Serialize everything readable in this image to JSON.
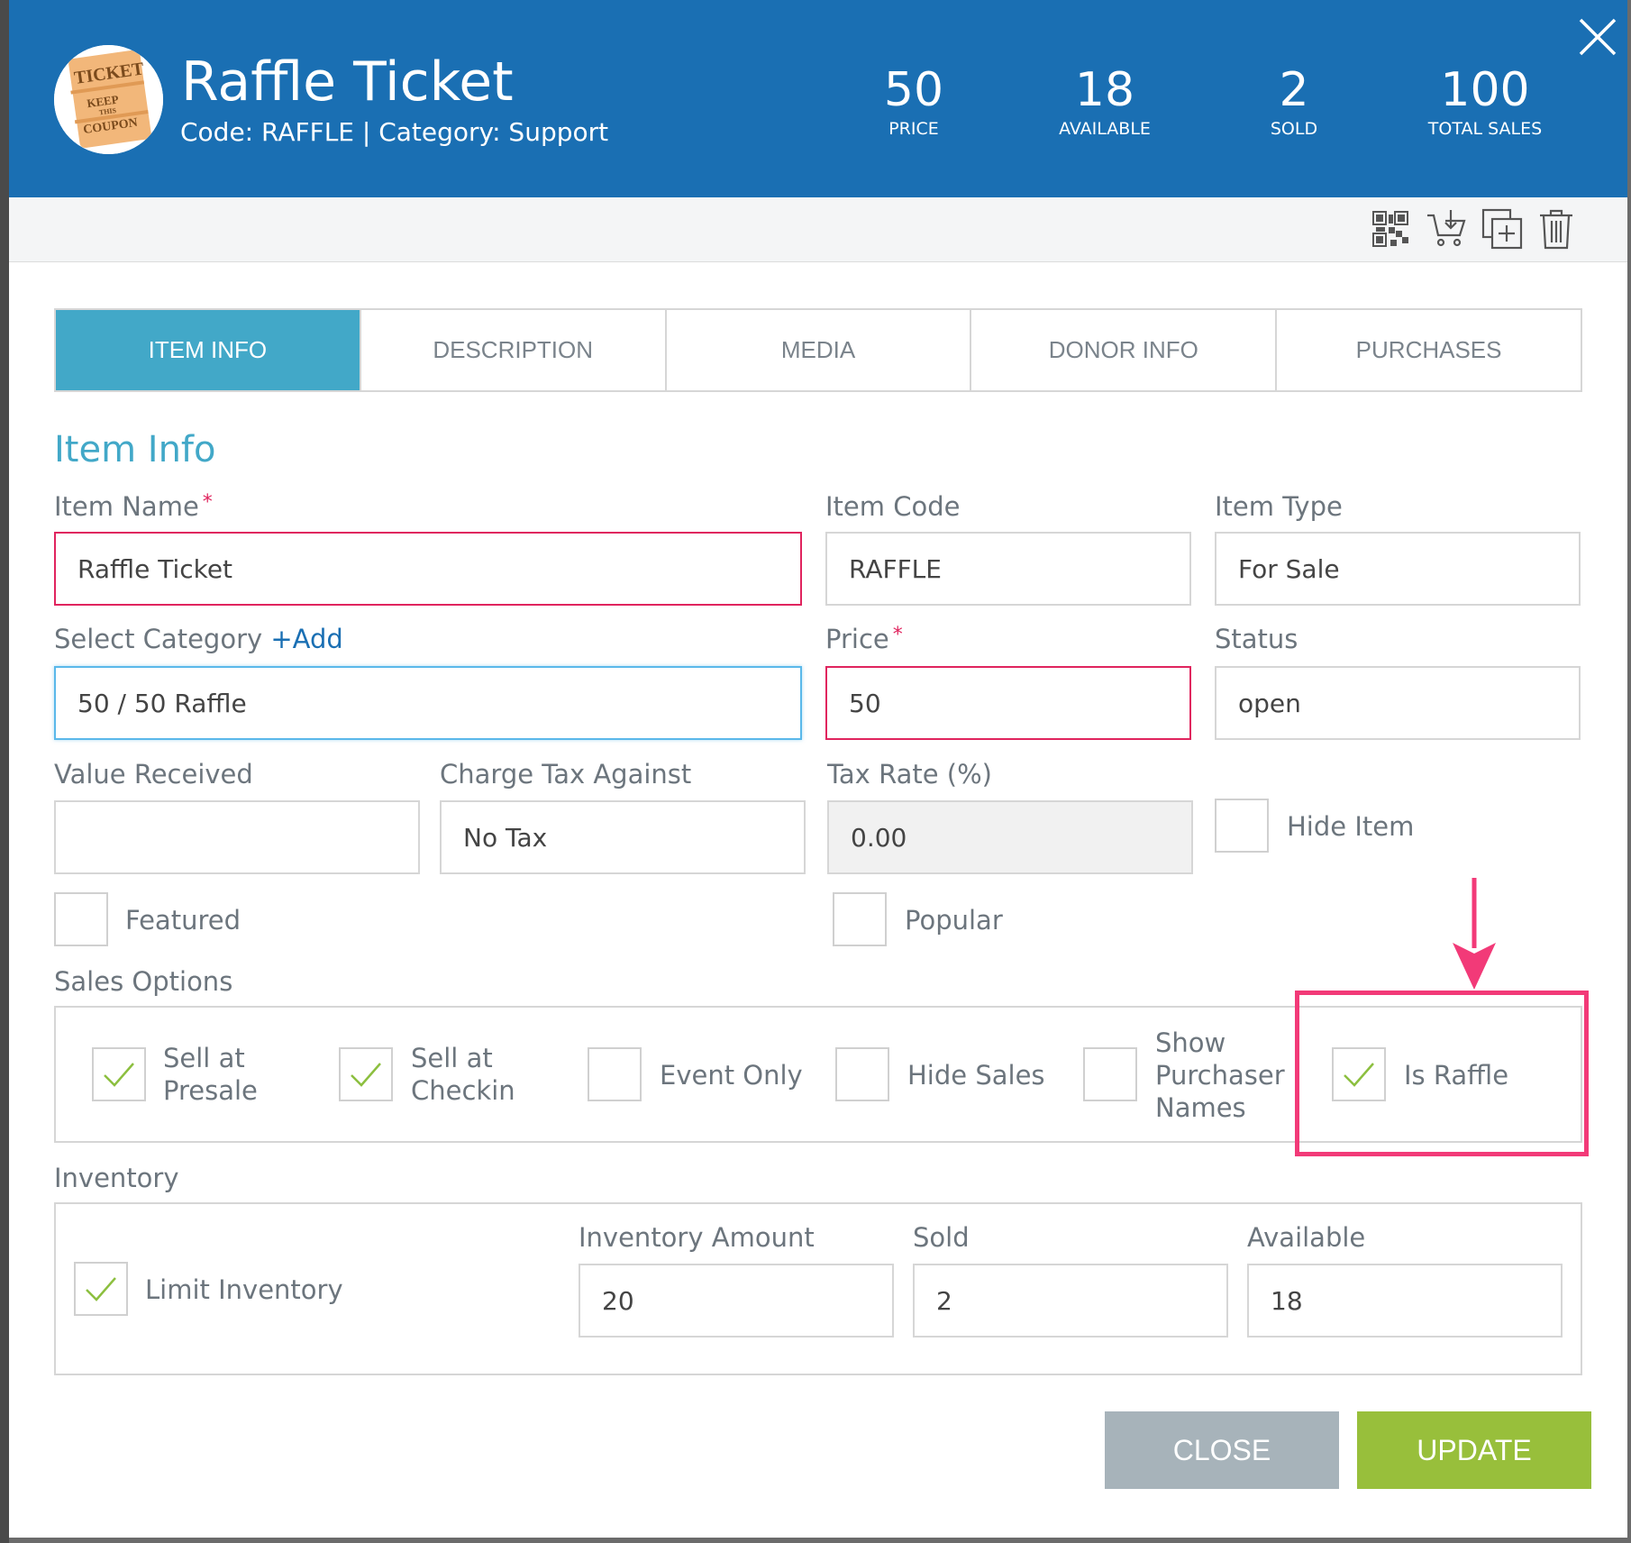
{
  "header": {
    "title": "Raffle Ticket",
    "subtitle": "Code: RAFFLE | Category: Support",
    "stats": [
      {
        "value": "50",
        "label": "PRICE"
      },
      {
        "value": "18",
        "label": "AVAILABLE"
      },
      {
        "value": "2",
        "label": "SOLD"
      },
      {
        "value": "100",
        "label": "TOTAL SALES"
      }
    ],
    "image_text": [
      "TICKET",
      "KEEP",
      "THIS",
      "COUPON"
    ]
  },
  "toolbar": {
    "icons": [
      "qr-code-icon",
      "cart-download-icon",
      "duplicate-icon",
      "trash-icon"
    ]
  },
  "tabs": [
    {
      "label": "ITEM INFO",
      "active": true
    },
    {
      "label": "DESCRIPTION",
      "active": false
    },
    {
      "label": "MEDIA",
      "active": false
    },
    {
      "label": "DONOR INFO",
      "active": false
    },
    {
      "label": "PURCHASES",
      "active": false
    }
  ],
  "form": {
    "section_title": "Item Info",
    "required_mark": "*",
    "item_name": {
      "label": "Item Name",
      "value": "Raffle Ticket"
    },
    "item_code": {
      "label": "Item Code",
      "value": "RAFFLE"
    },
    "item_type": {
      "label": "Item Type",
      "value": "For Sale"
    },
    "category": {
      "label": "Select Category",
      "add_label": "+Add",
      "value": "50 / 50 Raffle"
    },
    "price": {
      "label": "Price",
      "value": "50"
    },
    "status": {
      "label": "Status",
      "value": "open"
    },
    "value_received": {
      "label": "Value Received",
      "value": ""
    },
    "charge_tax": {
      "label": "Charge Tax Against",
      "value": "No Tax"
    },
    "tax_rate": {
      "label": "Tax Rate (%)",
      "value": "0.00"
    },
    "hide_item": {
      "label": "Hide Item",
      "checked": false
    },
    "featured": {
      "label": "Featured",
      "checked": false
    },
    "popular": {
      "label": "Popular",
      "checked": false
    }
  },
  "sales_options": {
    "title": "Sales Options",
    "options": [
      {
        "label_line1": "Sell at",
        "label_line2": "Presale",
        "checked": true
      },
      {
        "label_line1": "Sell at",
        "label_line2": "Checkin",
        "checked": true
      },
      {
        "label": "Event Only",
        "checked": false
      },
      {
        "label": "Hide Sales",
        "checked": false
      },
      {
        "label_line1": "Show",
        "label_line2": "Purchaser",
        "label_line3": "Names",
        "checked": false
      },
      {
        "label": "Is Raffle",
        "checked": true
      }
    ]
  },
  "inventory": {
    "title": "Inventory",
    "limit_label": "Limit Inventory",
    "limit_checked": true,
    "amount": {
      "label": "Inventory Amount",
      "value": "20"
    },
    "sold": {
      "label": "Sold",
      "value": "2"
    },
    "available": {
      "label": "Available",
      "value": "18"
    }
  },
  "buttons": {
    "close": "CLOSE",
    "update": "UPDATE"
  },
  "colors": {
    "header_bg": "#1a6fb3",
    "tab_active": "#42a8c8",
    "error": "#e0245e",
    "highlight": "#f23a78",
    "update_btn": "#98bf3b",
    "close_btn": "#a7b3ba",
    "check": "#8cbf3f"
  }
}
